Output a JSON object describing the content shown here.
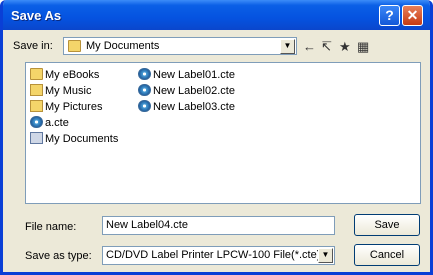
{
  "window": {
    "title": "Save As"
  },
  "toolbar": {
    "save_in_label": "Save in:",
    "save_in_value": "My Documents",
    "back_glyph": "←",
    "up_glyph": "↸",
    "newfolder_glyph": "★",
    "views_glyph": "▦"
  },
  "files": {
    "col1": [
      "My eBooks",
      "My Music",
      "My Pictures",
      "a.cte",
      "My Documents"
    ],
    "col2": [
      "New Label01.cte",
      "New Label02.cte",
      "New Label03.cte"
    ]
  },
  "form": {
    "filename_label": "File name:",
    "filename_value": "New Label04.cte",
    "type_label": "Save as type:",
    "type_value": "CD/DVD Label Printer LPCW-100 File(*.cte)"
  },
  "buttons": {
    "save": "Save",
    "cancel": "Cancel"
  },
  "colors": {
    "title_bar": "#0553e0",
    "dialog_bg": "#ece9d8"
  }
}
